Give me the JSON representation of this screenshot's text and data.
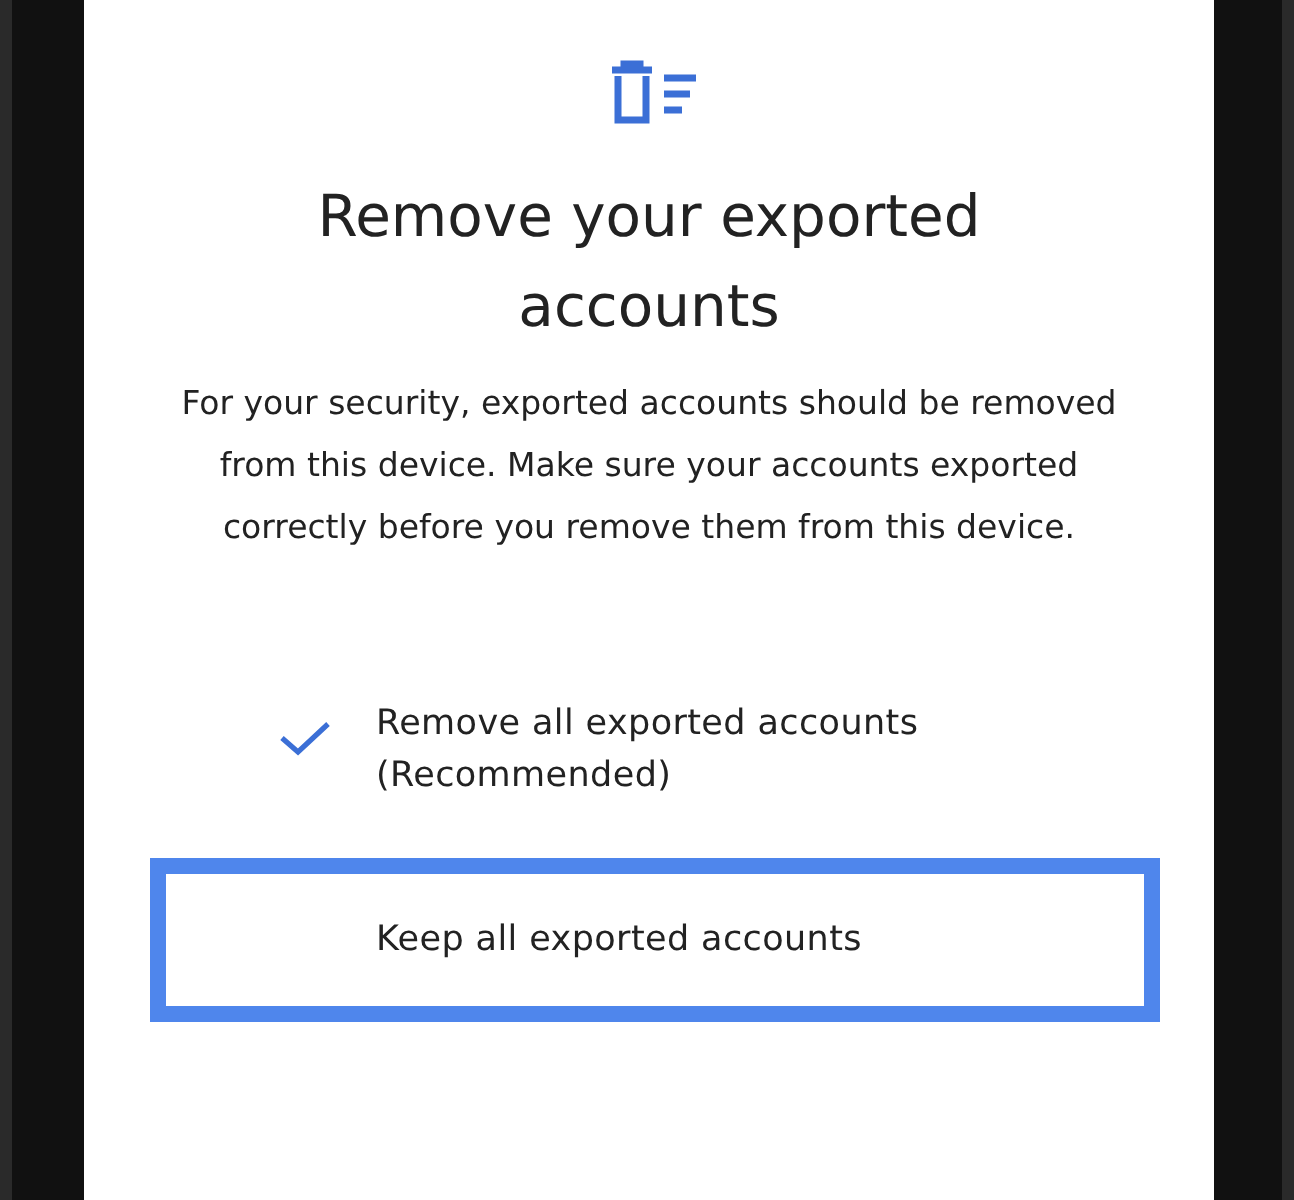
{
  "title": "Remove your exported accounts",
  "description": "For your security, exported accounts should be removed from this device. Make sure your accounts exported correctly before you remove them from this device.",
  "options": [
    {
      "label": "Remove all exported accounts (Recommended)",
      "selected": true,
      "highlighted": false
    },
    {
      "label": "Keep all exported accounts",
      "selected": false,
      "highlighted": true
    }
  ]
}
